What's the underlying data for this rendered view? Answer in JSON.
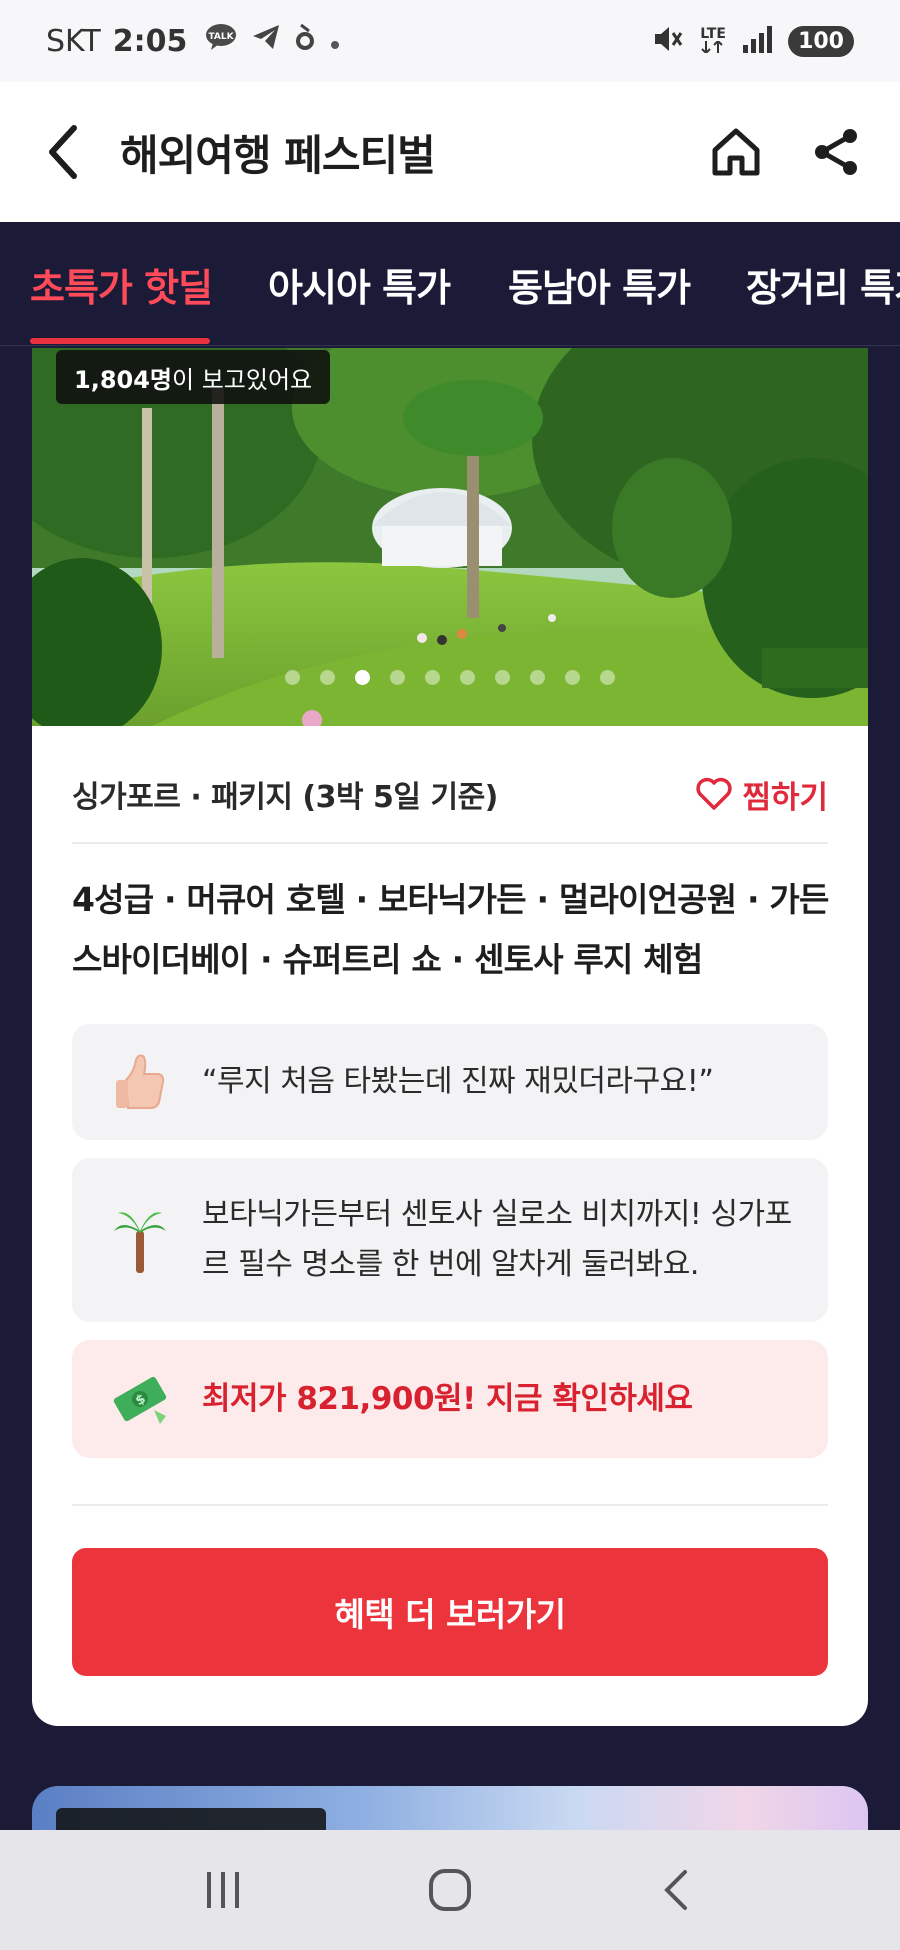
{
  "status_bar": {
    "carrier": "SKT",
    "time": "2:05",
    "talk_badge": "TALK",
    "network": "LTE",
    "battery": "100",
    "icons": [
      "kakaotalk-icon",
      "telegram-icon",
      "app-icon",
      "dot-icon",
      "mute-icon",
      "lte-icon",
      "signal-icon",
      "battery-icon"
    ]
  },
  "header": {
    "title": "해외여행 페스티벌",
    "icons": [
      "back-arrow-icon",
      "home-icon",
      "share-icon"
    ]
  },
  "tabs": [
    {
      "label": "초특가 핫딜",
      "active": true
    },
    {
      "label": "아시아 특가",
      "active": false
    },
    {
      "label": "동남아 특가",
      "active": false
    },
    {
      "label": "장거리 특가",
      "active": false
    }
  ],
  "colors": {
    "accent": "#e8323f",
    "page_bg": "#1b1b38",
    "cta": "#ec343d",
    "promo_bg": "#fdeaea"
  },
  "product": {
    "viewers_count": "1,804명",
    "viewers_suffix": "이 보고있어요",
    "carousel": {
      "total": 10,
      "active_index": 2
    },
    "destination": "싱가포르 · 패키지 (3박 5일 기준)",
    "wishlist_label": "찜하기",
    "title": "4성급 · 머큐어 호텔 · 보타닉가든 · 멀라이언공원 · 가든스바이더베이 · 슈퍼트리 쇼 · 센토사 루지 체험",
    "review_quote": "“루지 처음 타봤는데 진짜 재밌더라구요!”",
    "description": "보타닉가든부터 센토사 실로소 비치까지! 싱가포르 필수 명소를 한 번에 알차게 둘러봐요.",
    "price_promo": "최저가 821,900원! 지금 확인하세요",
    "cta_label": "혜택 더 보러가기",
    "icons": [
      "thumbs-up-icon",
      "palm-tree-icon",
      "money-icon",
      "heart-icon"
    ]
  },
  "nav_bar": {
    "icons": [
      "recent-apps-icon",
      "home-circle-icon",
      "back-chevron-icon"
    ]
  }
}
